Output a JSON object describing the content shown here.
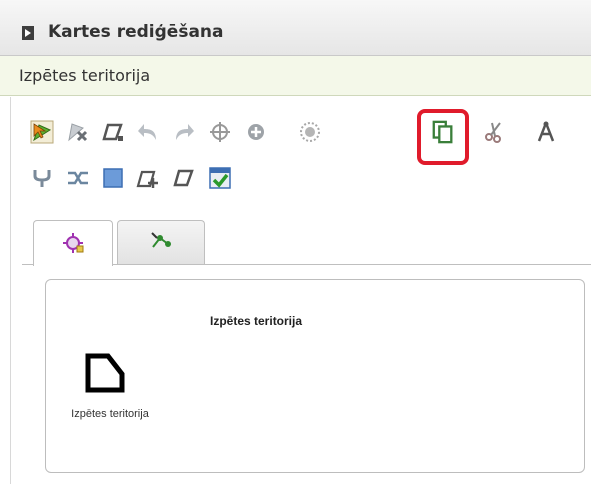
{
  "header": {
    "title": "Kartes rediģēšana",
    "toggle_icon": "expand-arrow-icon"
  },
  "section": {
    "title": "Izpētes teritorija"
  },
  "toolbar": {
    "row1": [
      "select-icon",
      "delete-feature-icon",
      "edit-vertices-icon",
      "undo-icon",
      "redo-icon",
      "crosshair-icon",
      "add-point-icon",
      "buffer-icon",
      "copy-icon",
      "cut-icon",
      "split-icon"
    ],
    "row2": [
      "merge-icon",
      "reshape-icon",
      "square-icon",
      "add-part-icon",
      "edit-shape-icon",
      "save-check-icon"
    ],
    "highlighted": "copy-icon",
    "highlight_color": "#e01b2b"
  },
  "tabs": [
    {
      "icon": "feature-select-icon",
      "active": true
    },
    {
      "icon": "snap-move-icon",
      "active": false
    }
  ],
  "layer": {
    "title": "Izpētes teritorija",
    "legend_label": "Izpētes teritorija",
    "legend_icon": "polygon-icon"
  }
}
